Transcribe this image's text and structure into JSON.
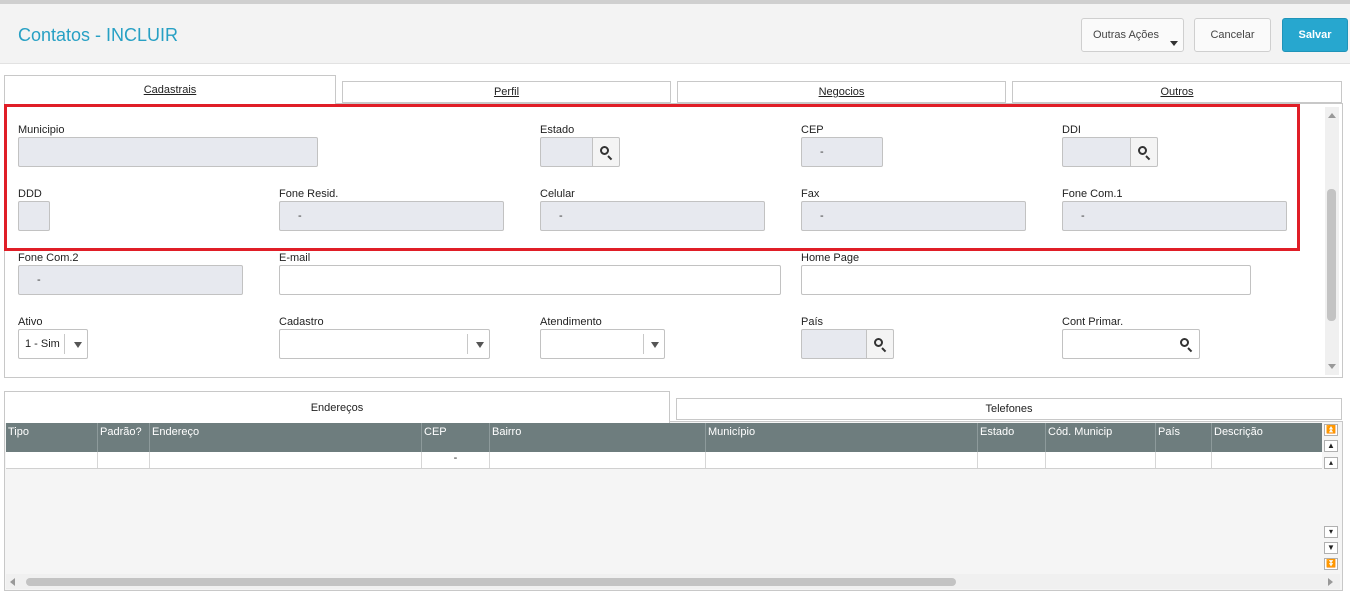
{
  "header": {
    "title": "Contatos - INCLUIR",
    "outras_acoes_label": "Outras Ações",
    "cancelar_label": "Cancelar",
    "salvar_label": "Salvar",
    "salvar_color": "#27a7cf",
    "title_color": "#27a0c4"
  },
  "tabs": [
    {
      "label": "Cadastrais",
      "active": true
    },
    {
      "label": "Perfil",
      "active": false
    },
    {
      "label": "Negocios",
      "active": false
    },
    {
      "label": "Outros",
      "active": false
    }
  ],
  "form": {
    "municipio": {
      "label": "Municipio",
      "value": ""
    },
    "estado": {
      "label": "Estado",
      "value": ""
    },
    "cep": {
      "label": "CEP",
      "value": "-"
    },
    "ddi": {
      "label": "DDI",
      "value": ""
    },
    "ddd": {
      "label": "DDD",
      "value": ""
    },
    "fone_resid": {
      "label": "Fone Resid.",
      "value": "-"
    },
    "celular": {
      "label": "Celular",
      "value": "-"
    },
    "fax": {
      "label": "Fax",
      "value": "-"
    },
    "fone_com1": {
      "label": "Fone Com.1",
      "value": "-"
    },
    "fone_com2": {
      "label": "Fone Com.2",
      "value": "-"
    },
    "email": {
      "label": "E-mail",
      "value": ""
    },
    "home_page": {
      "label": "Home Page",
      "value": ""
    },
    "ativo": {
      "label": "Ativo",
      "value": "1 - Sim"
    },
    "cadastro": {
      "label": "Cadastro",
      "value": ""
    },
    "atendimento": {
      "label": "Atendimento",
      "value": ""
    },
    "pais": {
      "label": "País",
      "value": ""
    },
    "cont_primar": {
      "label": "Cont Primar.",
      "value": ""
    }
  },
  "highlight_color": "#e01e27",
  "bottom_tabs": [
    {
      "label": "Endereços",
      "active": true
    },
    {
      "label": "Telefones",
      "active": false
    }
  ],
  "grid": {
    "columns": [
      "Tipo",
      "Padrão?",
      "Endereço",
      "CEP",
      "Bairro",
      "Município",
      "Estado",
      "Cód. Municip",
      "País",
      "Descrição"
    ],
    "rows": [
      [
        "",
        "",
        "",
        "-",
        "",
        "",
        "",
        "",
        "",
        ""
      ]
    ],
    "header_color": "#6e7d7e"
  }
}
